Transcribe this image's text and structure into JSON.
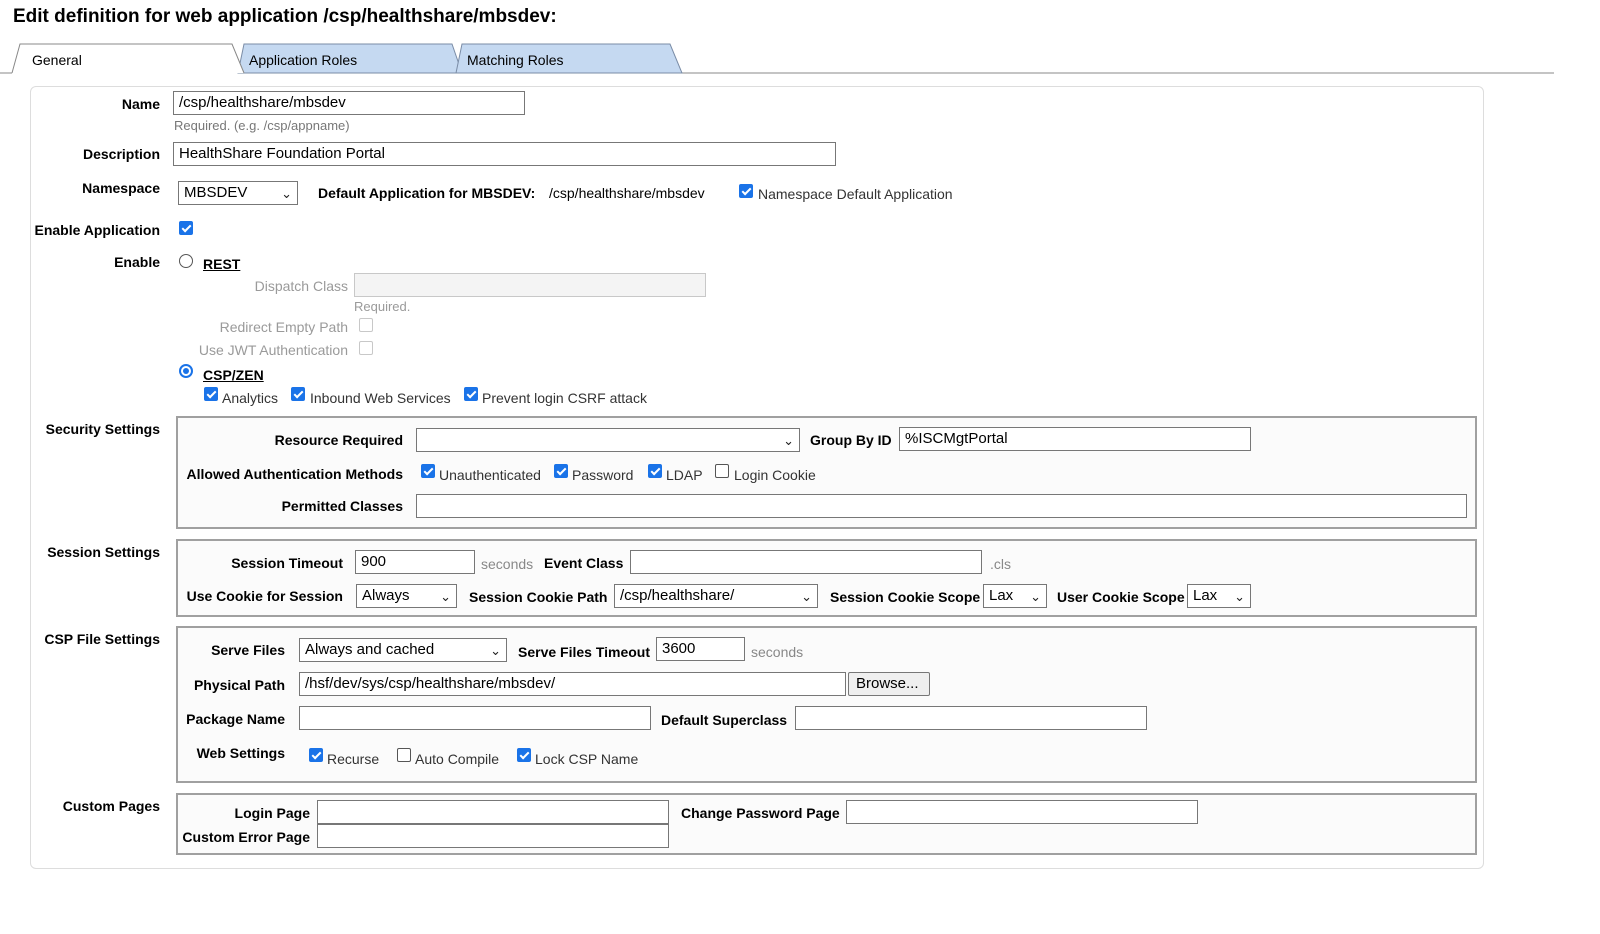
{
  "page_title": "Edit definition for web application /csp/healthshare/mbsdev:",
  "tabs": [
    {
      "label": "General",
      "active": true
    },
    {
      "label": "Application Roles",
      "active": false
    },
    {
      "label": "Matching Roles",
      "active": false
    }
  ],
  "colors": {
    "accent": "#1a73e8",
    "tab_inactive": "#c5d9f1",
    "fieldset_border": "#a0a0a0"
  },
  "general": {
    "name_label": "Name",
    "name_value": "/csp/healthshare/mbsdev",
    "name_hint": "Required. (e.g. /csp/appname)",
    "description_label": "Description",
    "description_value": "HealthShare Foundation Portal",
    "namespace_label": "Namespace",
    "namespace_value": "MBSDEV",
    "default_app_label": "Default Application for MBSDEV:",
    "default_app_value": "/csp/healthshare/mbsdev",
    "ns_default_label": "Namespace Default Application",
    "ns_default_checked": true,
    "enable_app_label": "Enable Application",
    "enable_app_checked": true,
    "enable_label": "Enable",
    "rest_label": "REST",
    "dispatch_label": "Dispatch Class",
    "dispatch_value": "",
    "dispatch_hint": "Required.",
    "redirect_label": "Redirect Empty Path",
    "jwt_label": "Use JWT Authentication",
    "cspzen_label": "CSP/ZEN",
    "analytics_label": "Analytics",
    "inbound_label": "Inbound Web Services",
    "csrf_label": "Prevent login CSRF attack"
  },
  "security": {
    "section_label": "Security Settings",
    "resource_label": "Resource Required",
    "resource_value": "",
    "group_label": "Group By ID",
    "group_value": "%ISCMgtPortal",
    "auth_label": "Allowed Authentication Methods",
    "auth_unauth": "Unauthenticated",
    "auth_password": "Password",
    "auth_ldap": "LDAP",
    "auth_cookie": "Login Cookie",
    "permitted_label": "Permitted Classes",
    "permitted_value": ""
  },
  "session": {
    "section_label": "Session Settings",
    "timeout_label": "Session Timeout",
    "timeout_value": "900",
    "timeout_unit": "seconds",
    "event_label": "Event Class",
    "event_value": "",
    "event_suffix": ".cls",
    "cookie_label": "Use Cookie for Session",
    "cookie_value": "Always",
    "cookie_path_label": "Session Cookie Path",
    "cookie_path_value": "/csp/healthshare/",
    "cookie_scope_label": "Session Cookie Scope",
    "cookie_scope_value": "Lax",
    "user_scope_label": "User Cookie Scope",
    "user_scope_value": "Lax"
  },
  "csp": {
    "section_label": "CSP File Settings",
    "serve_label": "Serve Files",
    "serve_value": "Always and cached",
    "serve_timeout_label": "Serve Files Timeout",
    "serve_timeout_value": "3600",
    "serve_timeout_unit": "seconds",
    "path_label": "Physical Path",
    "path_value": "/hsf/dev/sys/csp/healthshare/mbsdev/",
    "browse_label": "Browse...",
    "package_label": "Package Name",
    "package_value": "",
    "superclass_label": "Default Superclass",
    "superclass_value": "",
    "web_label": "Web Settings",
    "recurse_label": "Recurse",
    "autocompile_label": "Auto Compile",
    "lockname_label": "Lock CSP Name"
  },
  "custom": {
    "section_label": "Custom Pages",
    "login_label": "Login Page",
    "login_value": "",
    "changepw_label": "Change Password Page",
    "changepw_value": "",
    "error_label": "Custom Error Page",
    "error_value": ""
  }
}
